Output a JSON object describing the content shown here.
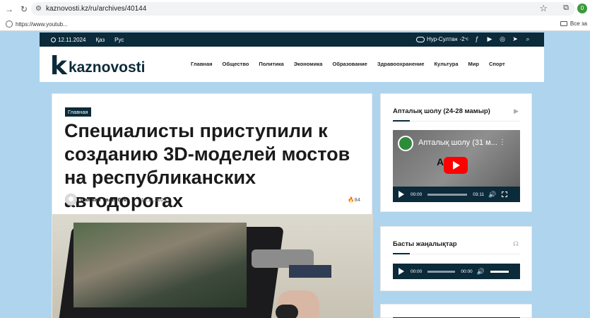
{
  "browser": {
    "url": "kaznovosti.kz/ru/archives/40144",
    "bookmark": "https://www.youtub...",
    "bookmarks_right": "Все за",
    "profile_initial": "0"
  },
  "site_top": {
    "date": "12.11.2024",
    "langs": [
      "Қаз",
      "Рус"
    ],
    "weather_city": "Нур-Султан",
    "weather_temp": "-2",
    "weather_unit": "℃"
  },
  "logo": {
    "mark": "k",
    "text": "kaznovosti"
  },
  "nav": [
    "Главная",
    "Общество",
    "Политика",
    "Экономика",
    "Образование",
    "Здравоохранение",
    "Культура",
    "Мир",
    "Спорт"
  ],
  "article": {
    "category": "Главная",
    "title": "Специалисты приступили к созданию 3D-моделей мостов на республиканских автодорогах",
    "author": "Санжар Төлеубек",
    "date": "11.11.2024",
    "views": "84"
  },
  "sidebar": {
    "widget1": {
      "title": "Апталық шолу (24-28 мамыр)",
      "video_title": "Апталық шолу (31 м...",
      "video_sub": "А       ық",
      "time_current": "00:00",
      "time_total": "03:11"
    },
    "widget2": {
      "title": "Басты жаңалықтар",
      "time_current": "00:00",
      "time_total": "00:00"
    }
  },
  "icons": {
    "back": "arrow-left-icon",
    "reload": "reload-icon",
    "star": "star-icon",
    "search": "search-icon"
  },
  "colors": {
    "brand_dark": "#0b2a3a",
    "page_bg": "#aed4ee",
    "youtube_red": "#ff0000"
  }
}
